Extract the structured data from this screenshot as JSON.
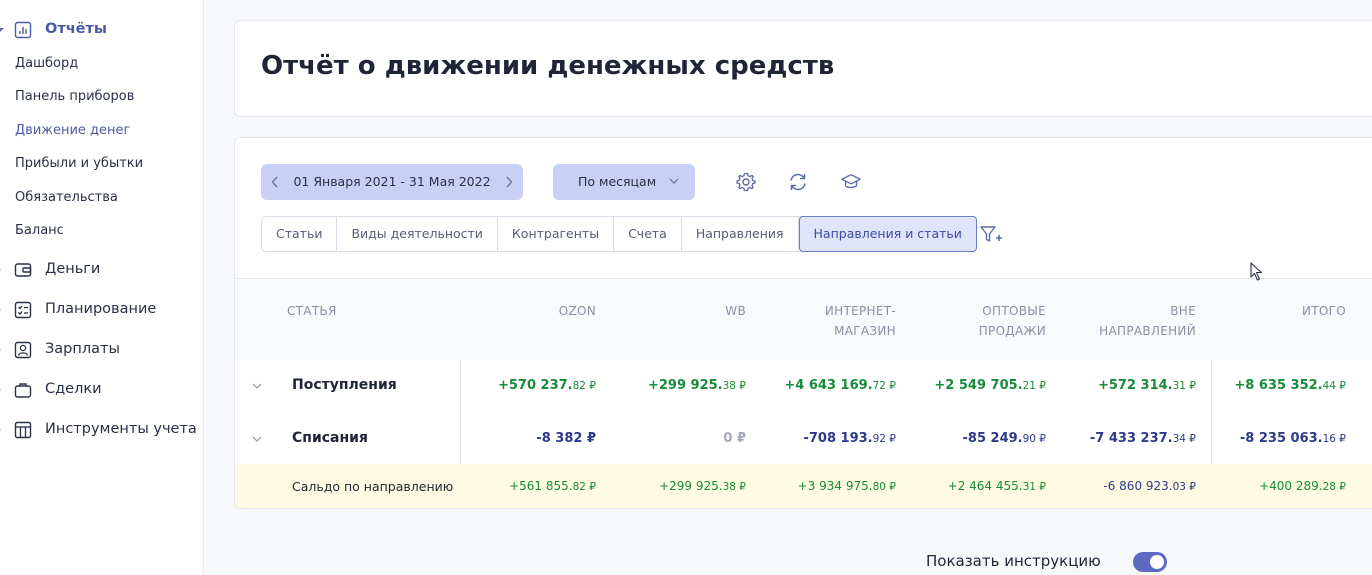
{
  "sidebar": {
    "groups": [
      {
        "label": "Отчёты",
        "icon": "bar-chart-icon"
      },
      {
        "label": "Деньги",
        "icon": "wallet-icon"
      },
      {
        "label": "Планирование",
        "icon": "checklist-icon"
      },
      {
        "label": "Зарплаты",
        "icon": "person-card-icon"
      },
      {
        "label": "Сделки",
        "icon": "briefcase-icon"
      },
      {
        "label": "Инструменты учета",
        "icon": "table-icon"
      }
    ],
    "reports_items": [
      "Дашборд",
      "Панель приборов",
      "Движение денег",
      "Прибыли и убытки",
      "Обязательства",
      "Баланс"
    ],
    "active_group": "Отчёты",
    "active_item": "Движение денег"
  },
  "page": {
    "title": "Отчёт о движении денежных средств"
  },
  "toolbar": {
    "date_range": "01 Января 2021 - 31 Мая 2022",
    "period": "По месяцам",
    "icons": [
      "gear-icon",
      "refresh-icon",
      "graduation-cap-icon"
    ]
  },
  "tabs": [
    "Статьи",
    "Виды деятельности",
    "Контрагенты",
    "Счета",
    "Направления",
    "Направления и статьи"
  ],
  "active_tab": "Направления и статьи",
  "table": {
    "headers": {
      "article": "СТАТЬЯ",
      "ozon": "OZON",
      "wb": "WB",
      "internet_1": "ИНТЕРНЕТ-",
      "internet_2": "МАГАЗИН",
      "wholesale_1": "ОПТОВЫЕ",
      "wholesale_2": "ПРОДАЖИ",
      "outside_1": "ВНЕ",
      "outside_2": "НАПРАВЛЕНИЙ",
      "total": "ИТОГО"
    },
    "rows": [
      {
        "label": "Поступления",
        "cells": [
          {
            "main": "+570 237.",
            "cents": "82 ₽",
            "kind": "pos"
          },
          {
            "main": "+299 925.",
            "cents": "38 ₽",
            "kind": "pos"
          },
          {
            "main": "+4 643 169.",
            "cents": "72 ₽",
            "kind": "pos"
          },
          {
            "main": "+2 549 705.",
            "cents": "21 ₽",
            "kind": "pos"
          },
          {
            "main": "+572 314.",
            "cents": "31 ₽",
            "kind": "pos"
          },
          {
            "main": "+8 635 352.",
            "cents": "44 ₽",
            "kind": "pos"
          }
        ]
      },
      {
        "label": "Списания",
        "cells": [
          {
            "main": "-8 382 ₽",
            "cents": "",
            "kind": "neg"
          },
          {
            "main": "0 ₽",
            "cents": "",
            "kind": "zero"
          },
          {
            "main": "-708 193.",
            "cents": "92 ₽",
            "kind": "neg"
          },
          {
            "main": "-85 249.",
            "cents": "90 ₽",
            "kind": "neg"
          },
          {
            "main": "-7 433 237.",
            "cents": "34 ₽",
            "kind": "neg"
          },
          {
            "main": "-8 235 063.",
            "cents": "16 ₽",
            "kind": "neg"
          }
        ]
      },
      {
        "label": "Сальдо по направлению",
        "cells": [
          {
            "main": "+561 855.",
            "cents": "82 ₽",
            "kind": "pos"
          },
          {
            "main": "+299 925.",
            "cents": "38 ₽",
            "kind": "pos"
          },
          {
            "main": "+3 934 975.",
            "cents": "80 ₽",
            "kind": "pos"
          },
          {
            "main": "+2 464 455.",
            "cents": "31 ₽",
            "kind": "pos"
          },
          {
            "main": "-6 860 923.",
            "cents": "03 ₽",
            "kind": "neg"
          },
          {
            "main": "+400 289.",
            "cents": "28 ₽",
            "kind": "pos"
          }
        ]
      }
    ]
  },
  "instruction": {
    "label": "Показать инструкцию",
    "enabled": true
  },
  "colors": {
    "accent": "#5b6ac2",
    "positive": "#168c3a",
    "negative": "#2d3a8a",
    "saldo_bg": "#fffbe2",
    "button_bg": "#c9d0f5"
  }
}
